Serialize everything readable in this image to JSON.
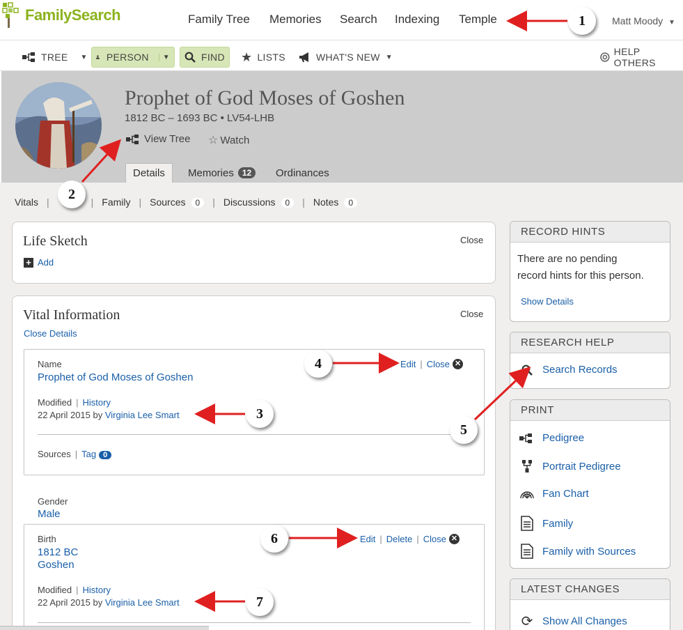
{
  "brand": {
    "logo_text": "FamilySearch"
  },
  "topnav": {
    "items": [
      "Family Tree",
      "Memories",
      "Search",
      "Indexing",
      "Temple"
    ],
    "user": "Matt Moody"
  },
  "toolbar": {
    "tree": "TREE",
    "person": "PERSON",
    "find": "FIND",
    "lists": "LISTS",
    "whats_new": "WHAT'S NEW",
    "help_others": "HELP OTHERS"
  },
  "person": {
    "name": "Prophet of God Moses of Goshen",
    "lifespan_id": "1812 BC – 1693 BC • LV54-LHB",
    "view_tree": "View Tree",
    "watch": "Watch"
  },
  "person_tabs": {
    "details": "Details",
    "memories": "Memories",
    "memories_count": "12",
    "ordinances": "Ordinances"
  },
  "subnav": {
    "vitals": "Vitals",
    "family": "Family",
    "sources": "Sources",
    "sources_count": "0",
    "discussions": "Discussions",
    "discussions_count": "0",
    "notes": "Notes",
    "notes_count": "0"
  },
  "life_sketch": {
    "title": "Life Sketch",
    "close": "Close",
    "add": "Add"
  },
  "vital_info": {
    "title": "Vital Information",
    "close": "Close",
    "close_details": "Close Details",
    "name_label": "Name",
    "name_value": "Prophet of God Moses of Goshen",
    "edit": "Edit",
    "close_item": "Close",
    "delete": "Delete",
    "modified": "Modified",
    "history": "History",
    "modified_date": "22 April 2015 by",
    "modified_by": "Virginia Lee Smart",
    "sources": "Sources",
    "tag": "Tag",
    "tag_count": "0",
    "gender_label": "Gender",
    "gender_value": "Male",
    "birth_label": "Birth",
    "birth_date": "1812 BC",
    "birth_place": "Goshen"
  },
  "record_hints": {
    "title": "RECORD HINTS",
    "text_line1": "There are no pending",
    "text_line2": "record hints for this person.",
    "show_details": "Show Details"
  },
  "research_help": {
    "title": "RESEARCH HELP",
    "search_records": "Search Records"
  },
  "print": {
    "title": "PRINT",
    "items": [
      "Pedigree",
      "Portrait Pedigree",
      "Fan Chart",
      "Family",
      "Family with Sources"
    ]
  },
  "latest_changes": {
    "title": "LATEST CHANGES",
    "show_all": "Show All Changes"
  },
  "callouts": [
    "1",
    "2",
    "3",
    "4",
    "5",
    "6",
    "7"
  ],
  "colors": {
    "link": "#1a5fa8",
    "brand_green": "#8cb31f",
    "arrow": "#e02020",
    "header_gray": "#cccccc",
    "content_bg": "#f0efee"
  }
}
